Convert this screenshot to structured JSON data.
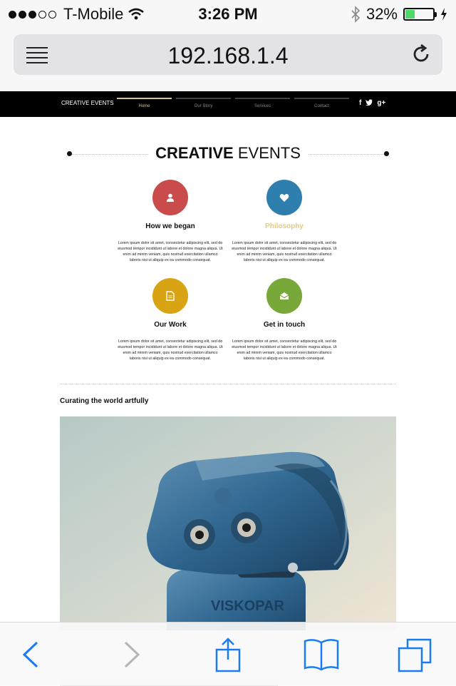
{
  "status": {
    "carrier": "T-Mobile",
    "time": "3:26 PM",
    "battery_pct": "32%",
    "signal_bars": 3,
    "battery_level": 0.32
  },
  "browser": {
    "url": "192.168.1.4"
  },
  "site": {
    "brand": "CREATIVE EVENTS",
    "nav": [
      {
        "label": "Home"
      },
      {
        "label": "Our Story"
      },
      {
        "label": "Services"
      },
      {
        "label": "Contact"
      }
    ],
    "social": [
      "f",
      "t",
      "g+"
    ],
    "title_bold": "CREATIVE",
    "title_rest": "EVENTS",
    "features": [
      {
        "title": "How we began",
        "color": "#c94b4b",
        "icon": "user-icon",
        "text": "Lorem ipsum dolor sit amet, consectetur adipiscing elit, sed do eiusmod tempor incididunt ut labore et dolore magna aliqua. Ut enim ad minim veniam, quis nostrud exercitation ullamco laboris nisi ut aliquip ex ea commodo consequat."
      },
      {
        "title": "Philosophy",
        "color": "#2f7fae",
        "icon": "heart-icon",
        "title_color": "#e8c97a",
        "text": "Lorem ipsum dolor sit amet, consectetur adipiscing elit, sed do eiusmod tempor incididunt ut labore et dolore magna aliqua. Ut enim ad minim veniam, quis nostrud exercitation ullamco laboris nisi ut aliquip ex ea commodo consequat."
      },
      {
        "title": "Our Work",
        "color": "#d9a414",
        "icon": "document-icon",
        "text": "Lorem ipsum dolor sit amet, consectetur adipiscing elit, sed do eiusmod tempor incididunt ut labore et dolore magna aliqua. Ut enim ad minim veniam, quis nostrud exercitation ullamco laboris nisi ut aliquip ex ea commodo consequat."
      },
      {
        "title": "Get in touch",
        "color": "#79a83a",
        "icon": "envelope-icon",
        "text": "Lorem ipsum dolor sit amet, consectetur adipiscing elit, sed do eiusmod tempor incididunt ut labore et dolore magna aliqua. Ut enim ad minim veniam, quis nostrud exercitation ullamco laboris nisi ut aliquip ex ea commodo consequat."
      }
    ],
    "subheading": "Curating the world artfully",
    "photo_label": "VISKOPAR"
  }
}
